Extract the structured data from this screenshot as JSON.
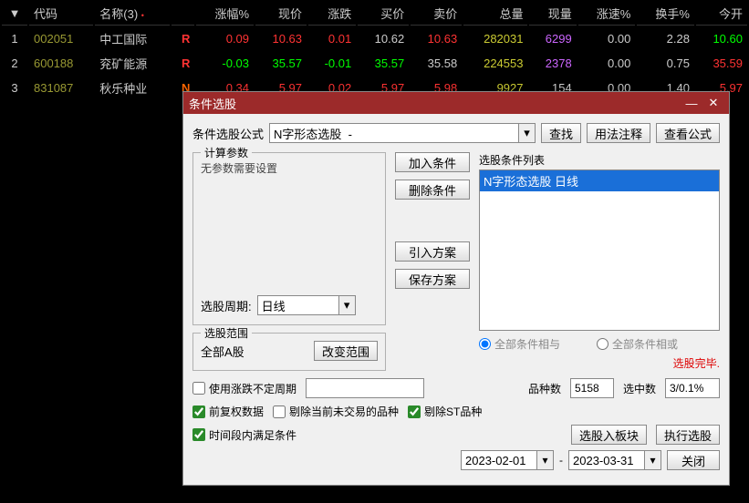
{
  "table": {
    "headers": [
      "",
      "代码",
      "名称(3)",
      "",
      "涨幅%",
      "现价",
      "涨跌",
      "买价",
      "卖价",
      "总量",
      "现量",
      "涨速%",
      "换手%",
      "今开"
    ],
    "rows": [
      {
        "idx": "1",
        "code": "002051",
        "name": "中工国际",
        "flag": "R",
        "flagClass": "flag-r",
        "pct": "0.09",
        "pctClass": "up",
        "price": "10.63",
        "priceClass": "up",
        "chg": "0.01",
        "chgClass": "up",
        "bid": "10.62",
        "bidClass": "neutral",
        "ask": "10.63",
        "askClass": "up",
        "vol": "282031",
        "volClass": "vol-y",
        "cur": "6299",
        "curClass": "vol-p",
        "speed": "0.00",
        "speedClass": "neutral",
        "turn": "2.28",
        "turnClass": "neutral",
        "open": "10.60",
        "openClass": "down"
      },
      {
        "idx": "2",
        "code": "600188",
        "name": "兖矿能源",
        "flag": "R",
        "flagClass": "flag-r",
        "pct": "-0.03",
        "pctClass": "down",
        "price": "35.57",
        "priceClass": "down",
        "chg": "-0.01",
        "chgClass": "down",
        "bid": "35.57",
        "bidClass": "down",
        "ask": "35.58",
        "askClass": "neutral",
        "vol": "224553",
        "volClass": "vol-y",
        "cur": "2378",
        "curClass": "vol-p",
        "speed": "0.00",
        "speedClass": "neutral",
        "turn": "0.75",
        "turnClass": "neutral",
        "open": "35.59",
        "openClass": "up"
      },
      {
        "idx": "3",
        "code": "831087",
        "name": "秋乐种业",
        "flag": "N",
        "flagClass": "flag-n",
        "pct": "0.34",
        "pctClass": "up",
        "price": "5.97",
        "priceClass": "up",
        "chg": "0.02",
        "chgClass": "up",
        "bid": "5.97",
        "bidClass": "up",
        "ask": "5.98",
        "askClass": "up",
        "vol": "9927",
        "volClass": "vol-y",
        "cur": "154",
        "curClass": "neutral",
        "speed": "0.00",
        "speedClass": "neutral",
        "turn": "1.40",
        "turnClass": "neutral",
        "open": "5.97",
        "openClass": "up"
      }
    ]
  },
  "dialog": {
    "title": "条件选股",
    "formula_label": "条件选股公式",
    "formula_value": "N字形态选股  -",
    "btn_find": "查找",
    "btn_usage": "用法注释",
    "btn_view_formula": "查看公式",
    "calc_legend": "计算参数",
    "calc_text": "无参数需要设置",
    "period_label": "选股周期:",
    "period_value": "日线",
    "scope_legend": "选股范围",
    "scope_text": "全部A股",
    "btn_change_scope": "改变范围",
    "btn_add": "加入条件",
    "btn_del": "删除条件",
    "btn_import": "引入方案",
    "btn_save": "保存方案",
    "cond_label": "选股条件列表",
    "cond_item": "N字形态选股 日线",
    "radio_and": "全部条件相与",
    "radio_or": "全部条件相或",
    "hint": "选股完毕.",
    "cb_use_uncertain": "使用涨跌不定周期",
    "count_kinds_label": "品种数",
    "count_kinds_value": "5158",
    "count_sel_label": "选中数",
    "count_sel_value": "3/0.1%",
    "cb_fq": "前复权数据",
    "cb_excl_nontrade": "剔除当前未交易的品种",
    "cb_excl_st": "剔除ST品种",
    "cb_time_range": "时间段内满足条件",
    "btn_to_block": "选股入板块",
    "btn_exec": "执行选股",
    "date_from": "2023-02-01",
    "date_sep": "-",
    "date_to": "2023-03-31",
    "btn_close": "关闭"
  }
}
